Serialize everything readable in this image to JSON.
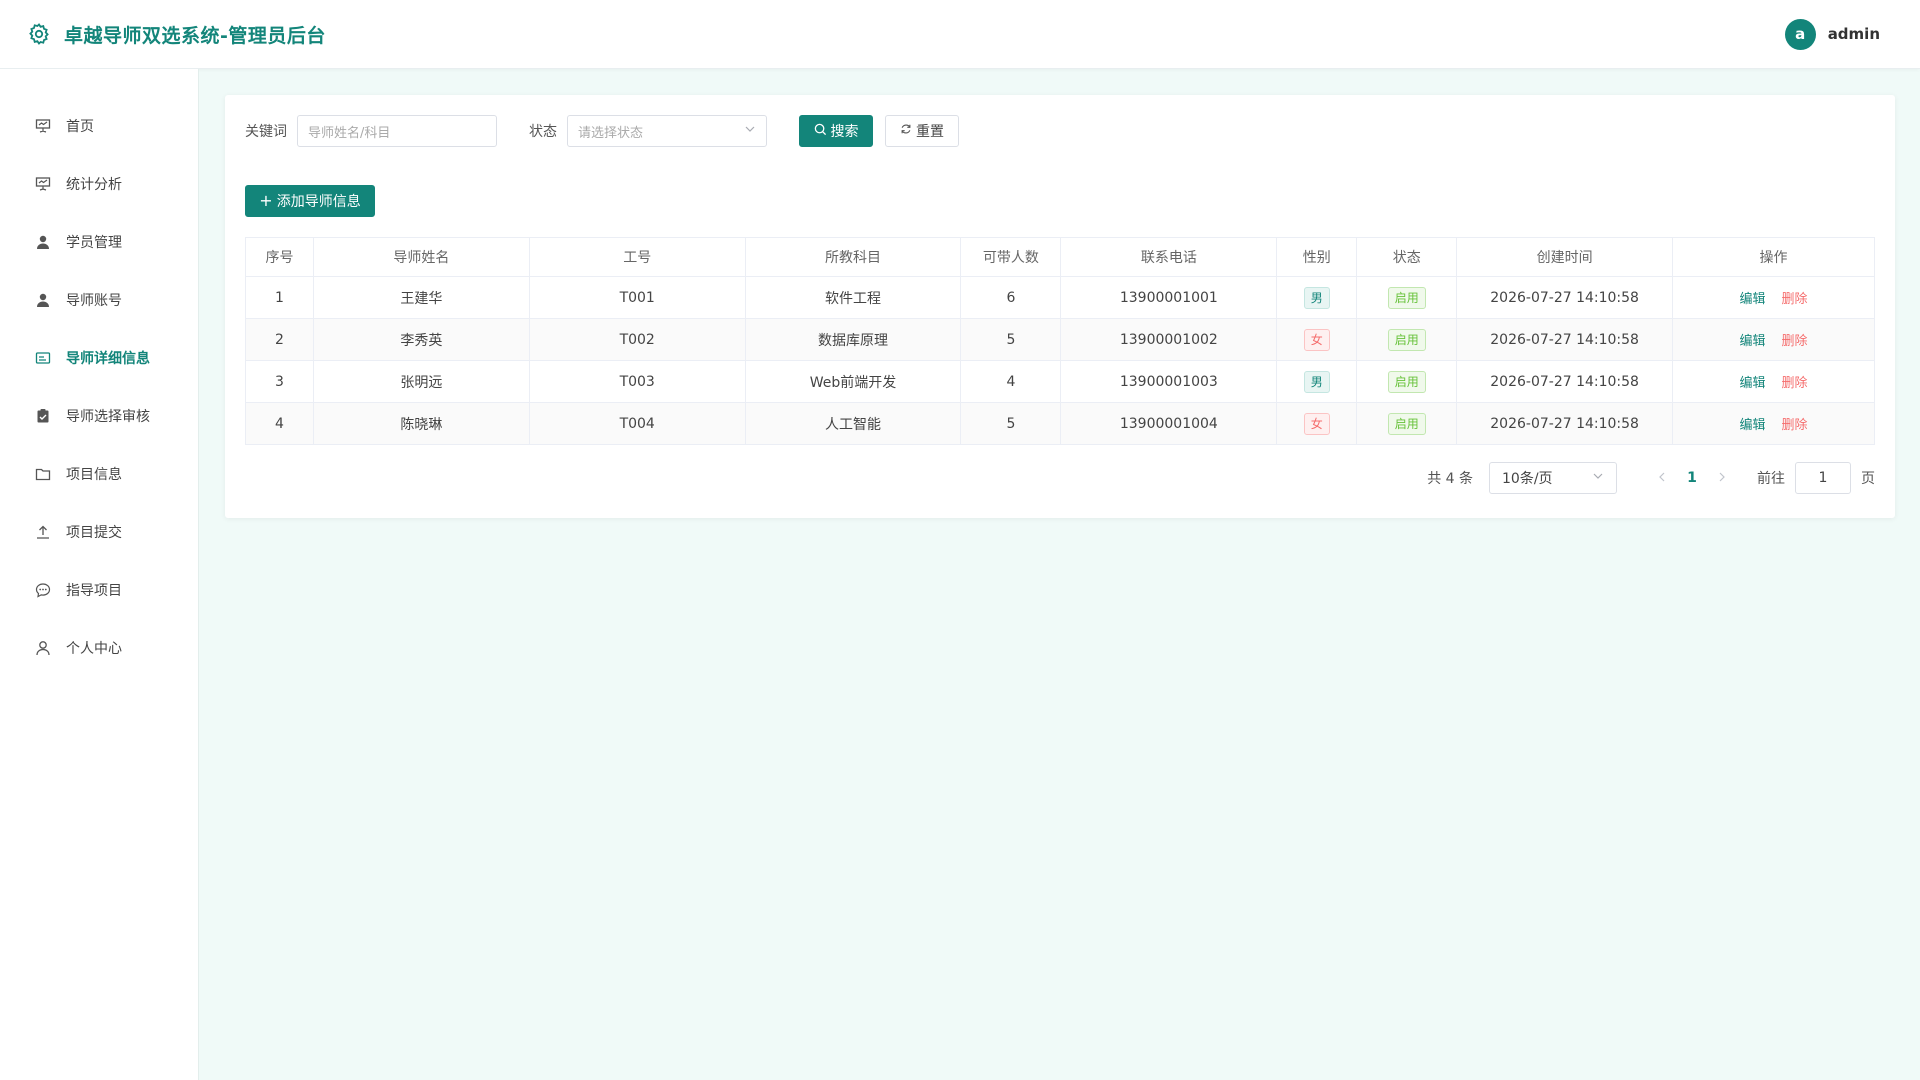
{
  "app": {
    "title": "卓越导师双选系统-管理员后台"
  },
  "user": {
    "avatar_letter": "a",
    "name": "admin"
  },
  "colors": {
    "brand": "#13857a",
    "danger": "#f56c6c",
    "success": "#67c23a",
    "page_bg": "#f0faf8"
  },
  "sidebar": {
    "items": [
      {
        "label": "首页",
        "icon": "presentation-board-icon"
      },
      {
        "label": "统计分析",
        "icon": "presentation-board-icon"
      },
      {
        "label": "学员管理",
        "icon": "user-icon"
      },
      {
        "label": "导师账号",
        "icon": "user-icon"
      },
      {
        "label": "导师详细信息",
        "icon": "id-card-icon",
        "active": true
      },
      {
        "label": "导师选择审核",
        "icon": "clipboard-check-icon"
      },
      {
        "label": "项目信息",
        "icon": "folder-icon"
      },
      {
        "label": "项目提交",
        "icon": "upload-icon"
      },
      {
        "label": "指导项目",
        "icon": "chat-bubble-icon"
      },
      {
        "label": "个人中心",
        "icon": "person-outline-icon"
      }
    ]
  },
  "search": {
    "keyword_label": "关键词",
    "keyword_placeholder": "导师姓名/科目",
    "status_label": "状态",
    "status_placeholder": "请选择状态",
    "search_button": "搜索",
    "reset_button": "重置"
  },
  "toolbar": {
    "add_button": "添加导师信息"
  },
  "table": {
    "columns": [
      "序号",
      "导师姓名",
      "工号",
      "所教科目",
      "可带人数",
      "联系电话",
      "性别",
      "状态",
      "创建时间",
      "操作"
    ],
    "rows": [
      {
        "index": "1",
        "name": "王建华",
        "id": "T001",
        "subject": "软件工程",
        "capacity": "6",
        "phone": "13900001001",
        "gender": "男",
        "status": "启用",
        "created": "2026-07-27 14:10:58"
      },
      {
        "index": "2",
        "name": "李秀英",
        "id": "T002",
        "subject": "数据库原理",
        "capacity": "5",
        "phone": "13900001002",
        "gender": "女",
        "status": "启用",
        "created": "2026-07-27 14:10:58"
      },
      {
        "index": "3",
        "name": "张明远",
        "id": "T003",
        "subject": "Web前端开发",
        "capacity": "4",
        "phone": "13900001003",
        "gender": "男",
        "status": "启用",
        "created": "2026-07-27 14:10:58"
      },
      {
        "index": "4",
        "name": "陈晓琳",
        "id": "T004",
        "subject": "人工智能",
        "capacity": "5",
        "phone": "13900001004",
        "gender": "女",
        "status": "启用",
        "created": "2026-07-27 14:10:58"
      }
    ],
    "edit_label": "编辑",
    "delete_label": "删除"
  },
  "pagination": {
    "total_text": "共 4 条",
    "page_size": "10条/页",
    "current_page": "1",
    "goto_label": "前往",
    "goto_value": "1",
    "page_suffix": "页"
  }
}
